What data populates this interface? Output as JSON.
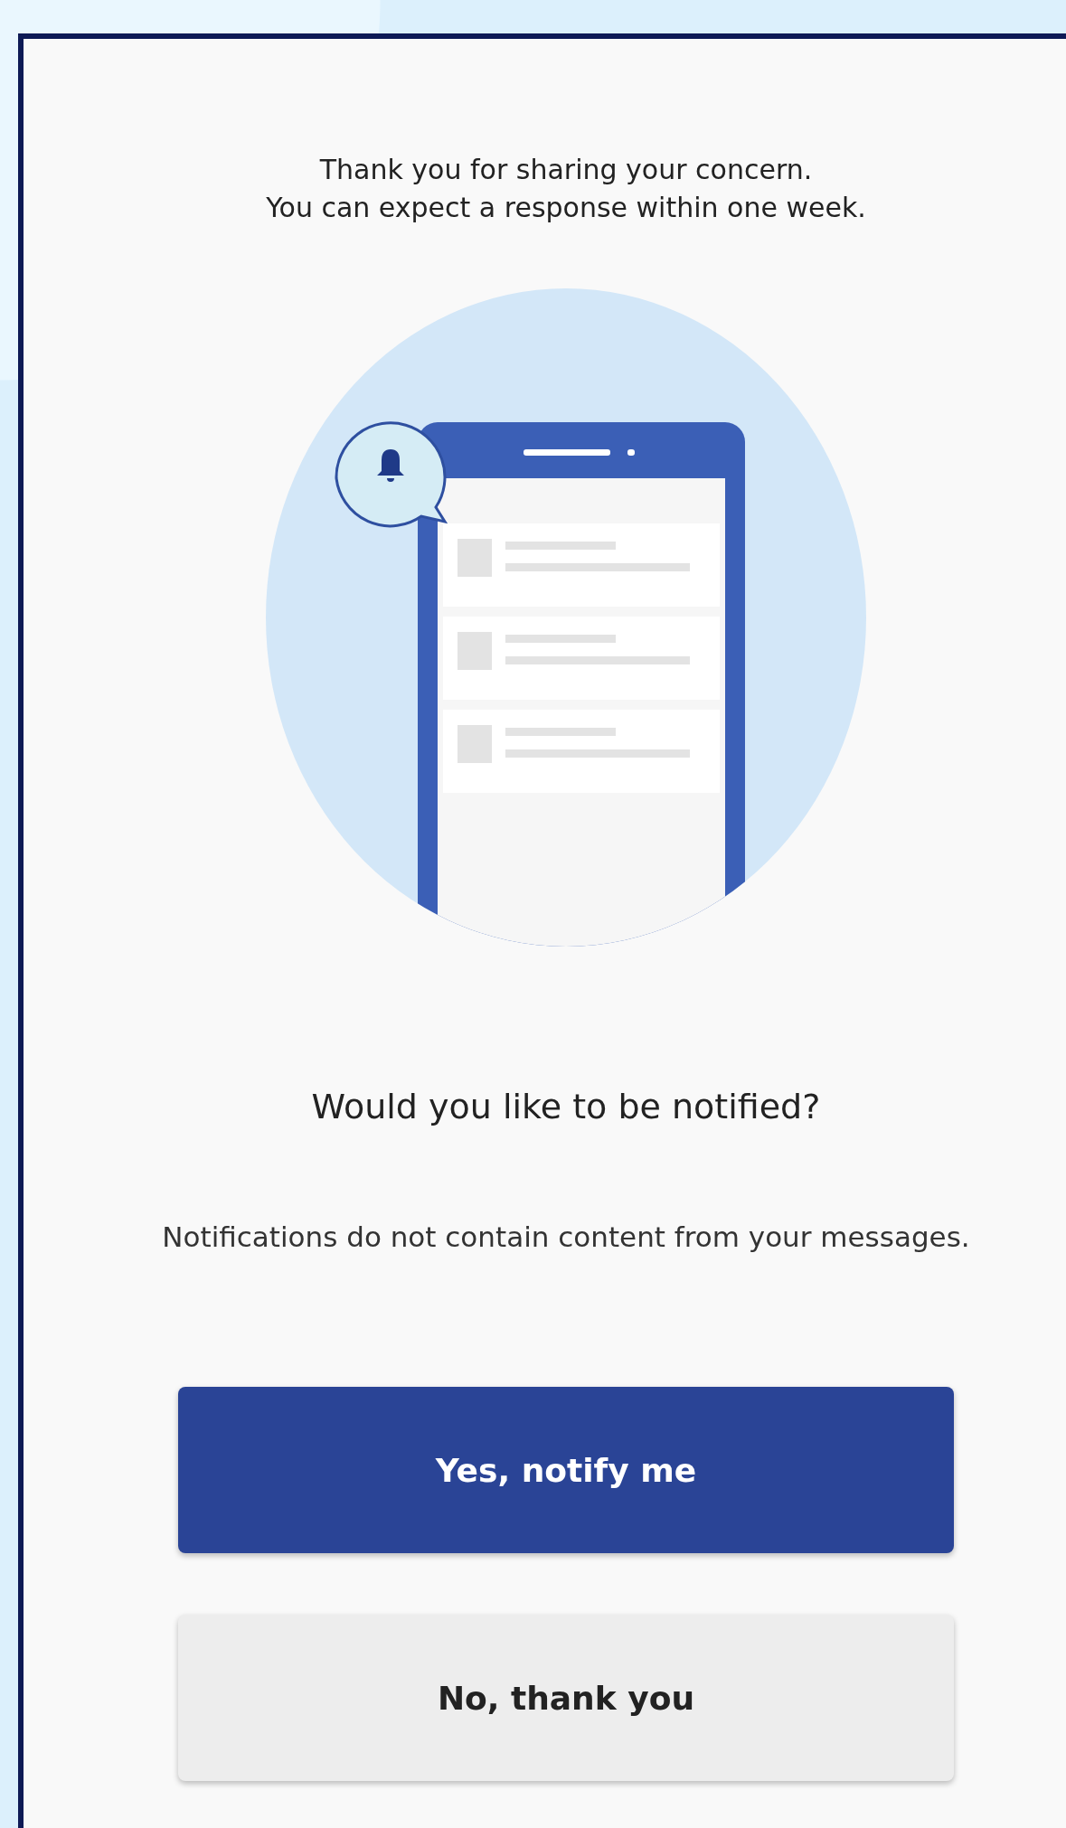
{
  "message": {
    "lines": [
      "Thank you for sharing your concern.",
      "You can expect a response within one week."
    ]
  },
  "prompt": {
    "title": "Would you like to be notified?",
    "note": "Notifications do not contain content from your messages."
  },
  "buttons": [
    {
      "label": "Yes, notify me",
      "kind": "primary"
    },
    {
      "label": "No, thank you",
      "kind": "secondary"
    }
  ]
}
